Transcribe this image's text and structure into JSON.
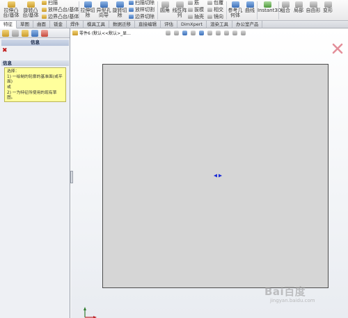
{
  "ribbon": {
    "groups": [
      {
        "big": "拉伸凸台/基体",
        "key": "extrude"
      },
      {
        "big": "旋转凸台/基体",
        "key": "revolve"
      },
      {
        "smalls": [
          "扫描",
          "放样凸台/基体",
          "边界凸台/基体"
        ],
        "key": "sweep"
      },
      {
        "big": "拉伸切除",
        "key": "cut_extrude"
      },
      {
        "big": "异型孔向导",
        "key": "hole"
      },
      {
        "big": "旋转切除",
        "key": "cut_revolve"
      },
      {
        "smalls": [
          "扫描切除",
          "放样切割",
          "边界切除"
        ],
        "key": "cut_misc"
      },
      {
        "big": "圆角",
        "key": "fillet"
      },
      {
        "big": "线性阵列",
        "key": "pattern"
      },
      {
        "smalls": [
          "筋",
          "拔模",
          "抽壳"
        ],
        "key": "rib"
      },
      {
        "smalls": [
          "包覆",
          "相交",
          "镜向"
        ],
        "key": "wrap"
      },
      {
        "big": "参考几何体",
        "key": "refgeom"
      },
      {
        "big": "曲线",
        "key": "curves"
      },
      {
        "big": "Instant3D",
        "key": "instant3d"
      },
      {
        "big": "组合",
        "key": "combine"
      },
      {
        "big": "局部",
        "key": "local"
      },
      {
        "big": "自由形",
        "key": "freeform"
      },
      {
        "big": "变形",
        "key": "deform"
      }
    ]
  },
  "tabs": [
    "特征",
    "草图",
    "曲面",
    "钣金",
    "焊件",
    "模具工具",
    "数据迁移",
    "直接编辑",
    "评估",
    "DimXpert",
    "渲染工具",
    "办公室产品"
  ],
  "active_tab": "特征",
  "left_panel": {
    "title": "信息",
    "message_header": "信息",
    "message_lines": [
      "选择：",
      "1) 一绘制的轮廓的基准面(或平面)",
      "或",
      "2) 一为特征所使用的现有草图。"
    ]
  },
  "graphics": {
    "breadcrumb": "零件6 (默认<<默认>_显...",
    "watermark": "Bai百度",
    "watermark_sub": "jingyan.baidu.com"
  }
}
